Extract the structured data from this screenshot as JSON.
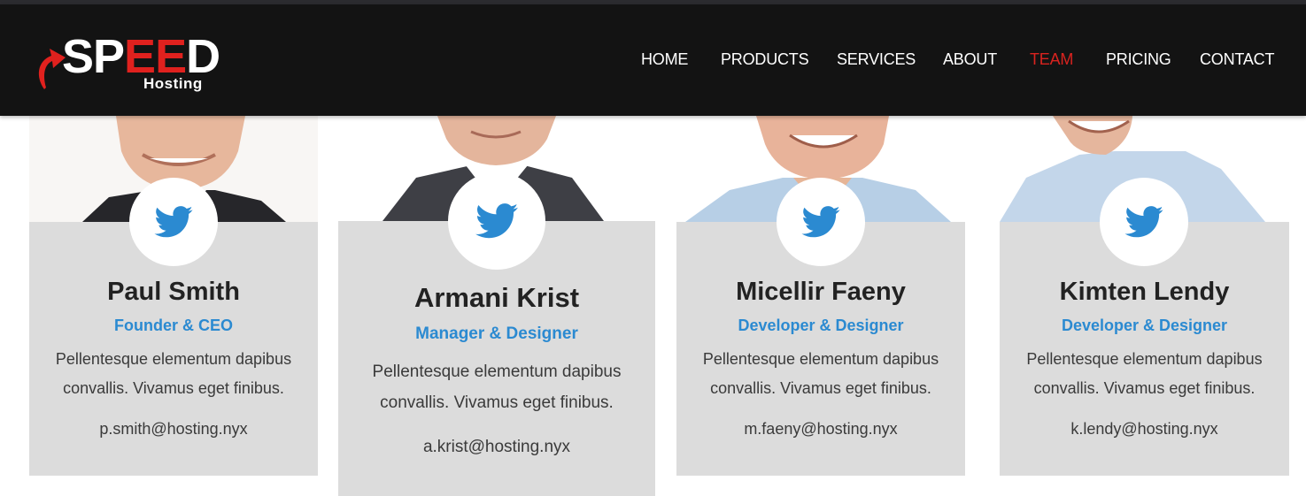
{
  "brand": {
    "name_part1": "SP",
    "name_part2": "EE",
    "name_part3": "D",
    "tagline": "Hosting",
    "accent": "#e0211e"
  },
  "nav": {
    "items": [
      {
        "label": "HOME"
      },
      {
        "label": "PRODUCTS"
      },
      {
        "label": "SERVICES"
      },
      {
        "label": "ABOUT"
      },
      {
        "label": "TEAM",
        "active": true
      },
      {
        "label": "PRICING"
      },
      {
        "label": "CONTACT"
      }
    ],
    "active_color": "#d9231f"
  },
  "team": [
    {
      "name": "Paul Smith",
      "role": "Founder & CEO",
      "desc_line1": "Pellentesque elementum dapibus",
      "desc_line2": "convallis. Vivamus eget finibus.",
      "email": "p.smith@hosting.nyx",
      "icon": "twitter-icon"
    },
    {
      "name": "Armani Krist",
      "role": "Manager & Designer",
      "desc_line1": "Pellentesque elementum dapibus",
      "desc_line2": "convallis. Vivamus eget finibus.",
      "email": "a.krist@hosting.nyx",
      "icon": "twitter-icon"
    },
    {
      "name": "Micellir Faeny",
      "role": "Developer & Designer",
      "desc_line1": "Pellentesque elementum dapibus",
      "desc_line2": "convallis. Vivamus eget finibus.",
      "email": "m.faeny@hosting.nyx",
      "icon": "twitter-icon"
    },
    {
      "name": "Kimten Lendy",
      "role": "Developer & Designer",
      "desc_line1": "Pellentesque elementum dapibus",
      "desc_line2": "convallis. Vivamus eget finibus.",
      "email": "k.lendy@hosting.nyx",
      "icon": "twitter-icon"
    }
  ],
  "colors": {
    "navbar": "#131313",
    "card": "#dcdcdc",
    "role": "#2b8ad1",
    "twitter": "#2b8ad1"
  }
}
